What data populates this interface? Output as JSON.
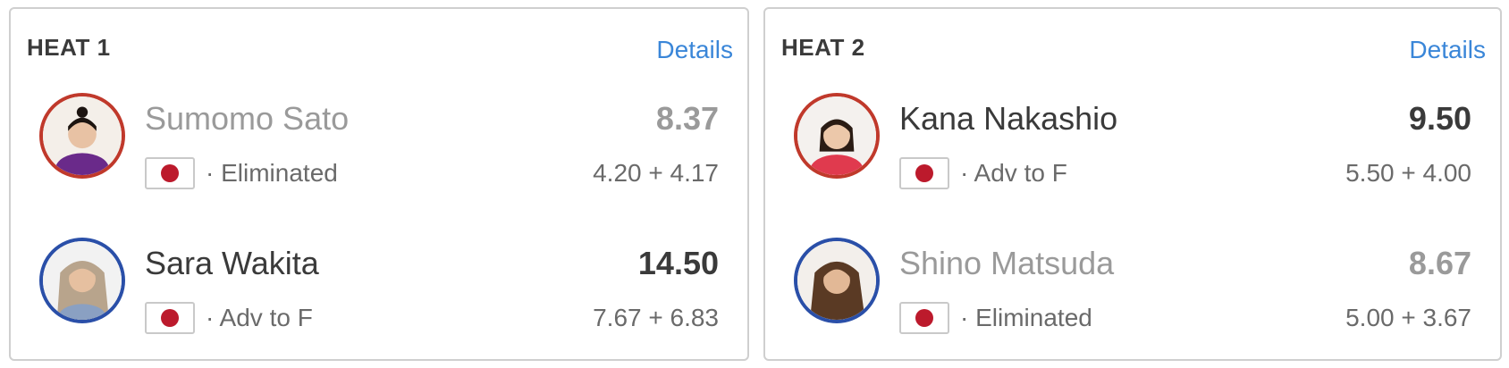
{
  "colors": {
    "accent_link": "#3a86d8",
    "flag_red": "#bc1a2c",
    "ring_red": "#c0392b",
    "ring_blue": "#2a4fa8"
  },
  "heats": [
    {
      "title": "HEAT 1",
      "details_label": "Details",
      "athletes": [
        {
          "name": "Sumomo Sato",
          "flag_icon": "japan-flag",
          "status": "· Eliminated",
          "total": "8.37",
          "waves": "4.20 + 4.17",
          "ring": "red",
          "eliminated": true
        },
        {
          "name": "Sara Wakita",
          "flag_icon": "japan-flag",
          "status": "· Adv to F",
          "total": "14.50",
          "waves": "7.67 + 6.83",
          "ring": "blue",
          "eliminated": false
        }
      ]
    },
    {
      "title": "HEAT 2",
      "details_label": "Details",
      "athletes": [
        {
          "name": "Kana Nakashio",
          "flag_icon": "japan-flag",
          "status": "· Adv to F",
          "total": "9.50",
          "waves": "5.50 + 4.00",
          "ring": "red",
          "eliminated": false
        },
        {
          "name": "Shino Matsuda",
          "flag_icon": "japan-flag",
          "status": "· Eliminated",
          "total": "8.67",
          "waves": "5.00 + 3.67",
          "ring": "blue",
          "eliminated": true
        }
      ]
    }
  ]
}
